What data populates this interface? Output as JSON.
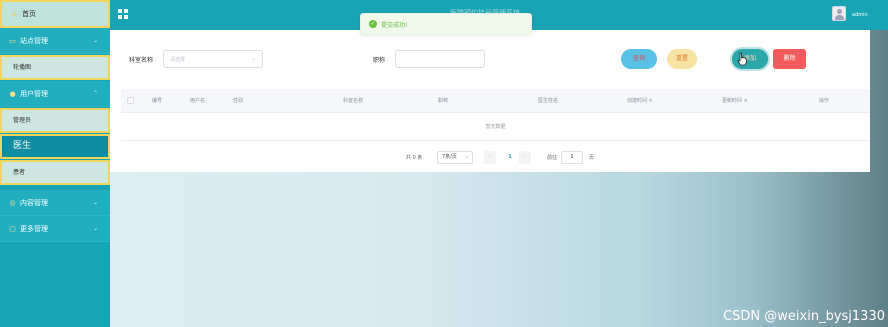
{
  "app": {
    "title": "医院预约挂号管理系统",
    "user": "admin"
  },
  "toast": {
    "text": "提交成功!",
    "icon": "success-check-icon"
  },
  "sidebar": {
    "items": [
      {
        "label": "首页",
        "icon": "home-icon"
      },
      {
        "label": "站点管理",
        "icon": "site-icon"
      },
      {
        "label": "轮播图"
      },
      {
        "label": "用户管理",
        "icon": "user-icon"
      },
      {
        "label": "管理员"
      },
      {
        "label": "医生"
      },
      {
        "label": "患者"
      },
      {
        "label": "内容管理",
        "icon": "content-icon"
      },
      {
        "label": "更多管理",
        "icon": "more-icon"
      }
    ]
  },
  "search": {
    "dept_label": "科室名称",
    "dept_placeholder": "请选择",
    "title_label": "职称",
    "title_value": ""
  },
  "buttons": {
    "search": "查询",
    "reset": "重置",
    "add": "添加",
    "delete": "删除"
  },
  "table": {
    "columns": [
      "编号",
      "用户名",
      "性别",
      "科室名称",
      "职称",
      "医生姓名",
      "创建时间 ≑",
      "更新时间 ≑",
      "操作"
    ],
    "empty_text": "暂无数据"
  },
  "pagination": {
    "total": "共 0 条",
    "page_size": "7条/页",
    "current": "1",
    "goto_label": "前往",
    "goto_value": "1",
    "page_unit": "页"
  },
  "watermark": "CSDN @weixin_bysj1330",
  "colors": {
    "primary": "#18a4b4",
    "highlight_border": "#f1d55a",
    "success": "#67c23a",
    "danger": "#f25b5b"
  }
}
